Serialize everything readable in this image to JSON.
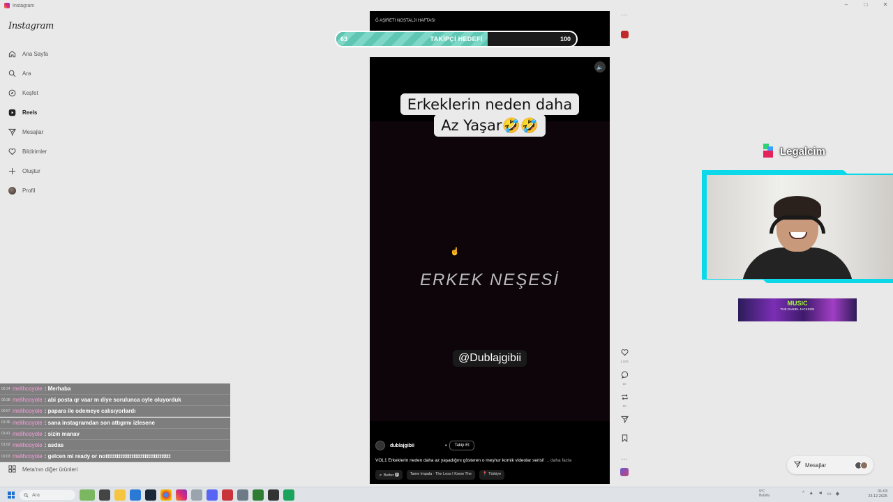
{
  "window": {
    "title": "Instagram",
    "controls": [
      "–",
      "□",
      "✕"
    ]
  },
  "sidebar": {
    "logo": "Instagram",
    "items": [
      {
        "label": "Ana Sayfa",
        "icon": "home-icon"
      },
      {
        "label": "Ara",
        "icon": "search-icon"
      },
      {
        "label": "Keşfet",
        "icon": "compass-icon"
      },
      {
        "label": "Reels",
        "icon": "reels-icon",
        "active": true
      },
      {
        "label": "Mesajlar",
        "icon": "send-icon"
      },
      {
        "label": "Bildirimler",
        "icon": "heart-icon"
      },
      {
        "label": "Oluştur",
        "icon": "plus-icon"
      },
      {
        "label": "Profil",
        "icon": "avatar"
      }
    ],
    "meta_more": "Meta'nın diğer ürünleri"
  },
  "chat": {
    "messages": [
      {
        "time": "00:34",
        "user": "melihcoyote",
        "text": ": Merhaba"
      },
      {
        "time": "00:38",
        "user": "melihcoyote",
        "text": ": abi posta qr vaar m diye sorulunca oyle oluyorduk"
      },
      {
        "time": "00:57",
        "user": "melihcoyote",
        "text": ": papara ile odemeye calısıyorlardı"
      },
      {
        "time": "01:36",
        "user": "melihcoyote",
        "text": ": sana instagramdan son attıgımı izlesene"
      },
      {
        "time": "01:41",
        "user": "melihcoyote",
        "text": ": sizin manav"
      },
      {
        "time": "01:02",
        "user": "melihcoyote",
        "text": ": asdas"
      },
      {
        "time": "01:03",
        "user": "melihcoyote",
        "text": ": gelcen mi ready or nottttttttttttttttttttttttttttttttttt"
      }
    ]
  },
  "prev_reel": {
    "caption": "Ğ AŞIRETI NOSTALJI HAFTASI"
  },
  "follower_goal": {
    "current": "63",
    "label": "TAKİPÇİ HEDEFİ",
    "target": "100",
    "progress": 0.63
  },
  "reel": {
    "title_line1": "Erkeklerin neden daha",
    "title_line2": "Az Yaşar🤣🤣",
    "center_text": "ERKEK NEŞESİ",
    "handle_text": "@Dublajgibii",
    "owner": "dublajgibii",
    "follow_label": "Takip Et",
    "description": "VOL1 Erkeklerin neden daha az yaşadığını gösteren o meşhur komik videolar serisi!",
    "more": "... daha fazla",
    "tags": [
      "♬ Better 🅴",
      "Tame Impala · The Less I Know The",
      "📍 Türkiye"
    ]
  },
  "actions": [
    {
      "icon": "heart-icon",
      "count": "1.975"
    },
    {
      "icon": "comment-icon",
      "count": "10"
    },
    {
      "icon": "repost-icon",
      "count": "10"
    },
    {
      "icon": "share-icon",
      "count": ""
    },
    {
      "icon": "bookmark-icon",
      "count": ""
    },
    {
      "icon": "more-icon",
      "count": ""
    }
  ],
  "messages_pill": {
    "label": "Mesajlar"
  },
  "sponsor": {
    "name": "Legalcim"
  },
  "banner": {
    "line1": "MUSIC",
    "line2": "THE DANIEL JACKSON"
  },
  "taskbar": {
    "search_placeholder": "Ara",
    "weather_temp": "9°C",
    "weather_desc": "Bulutlu",
    "time": "01:03",
    "date": "23.12.2025"
  },
  "colors": {
    "accent": "#0bd8e8",
    "goal_fill": "#5ec6b3",
    "chat_user": "#ff9fe0"
  }
}
